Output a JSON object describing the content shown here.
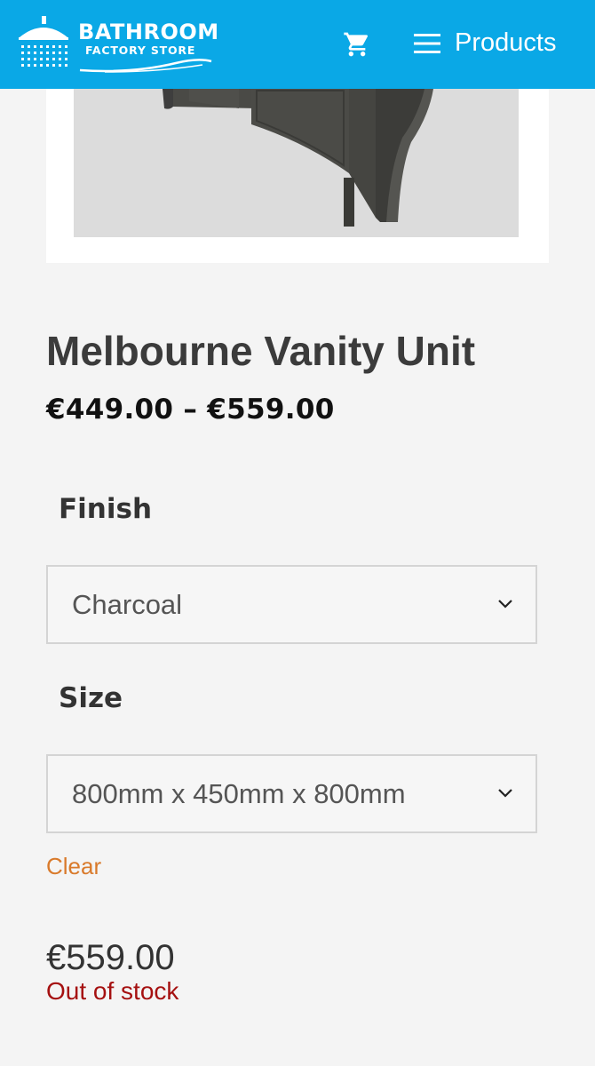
{
  "header": {
    "logo_line1": "BATHROOM",
    "logo_line2": "FACTORY STORE",
    "menu_label": "Products",
    "cart_icon": "cart-icon",
    "menu_icon": "hamburger-icon",
    "background": "#0aa8e6"
  },
  "product": {
    "title": "Melbourne Vanity Unit",
    "price_range": "€449.00 – €559.00",
    "image_icon": "vanity-unit-photo"
  },
  "variations": {
    "finish_label": "Finish",
    "finish_value": "Charcoal",
    "size_label": "Size",
    "size_value": "800mm x 450mm x 800mm",
    "clear_label": "Clear"
  },
  "selected": {
    "price": "€559.00",
    "stock_status": "Out of stock"
  },
  "colors": {
    "accent_link": "#d97a2b",
    "stock_red": "#a51010"
  }
}
